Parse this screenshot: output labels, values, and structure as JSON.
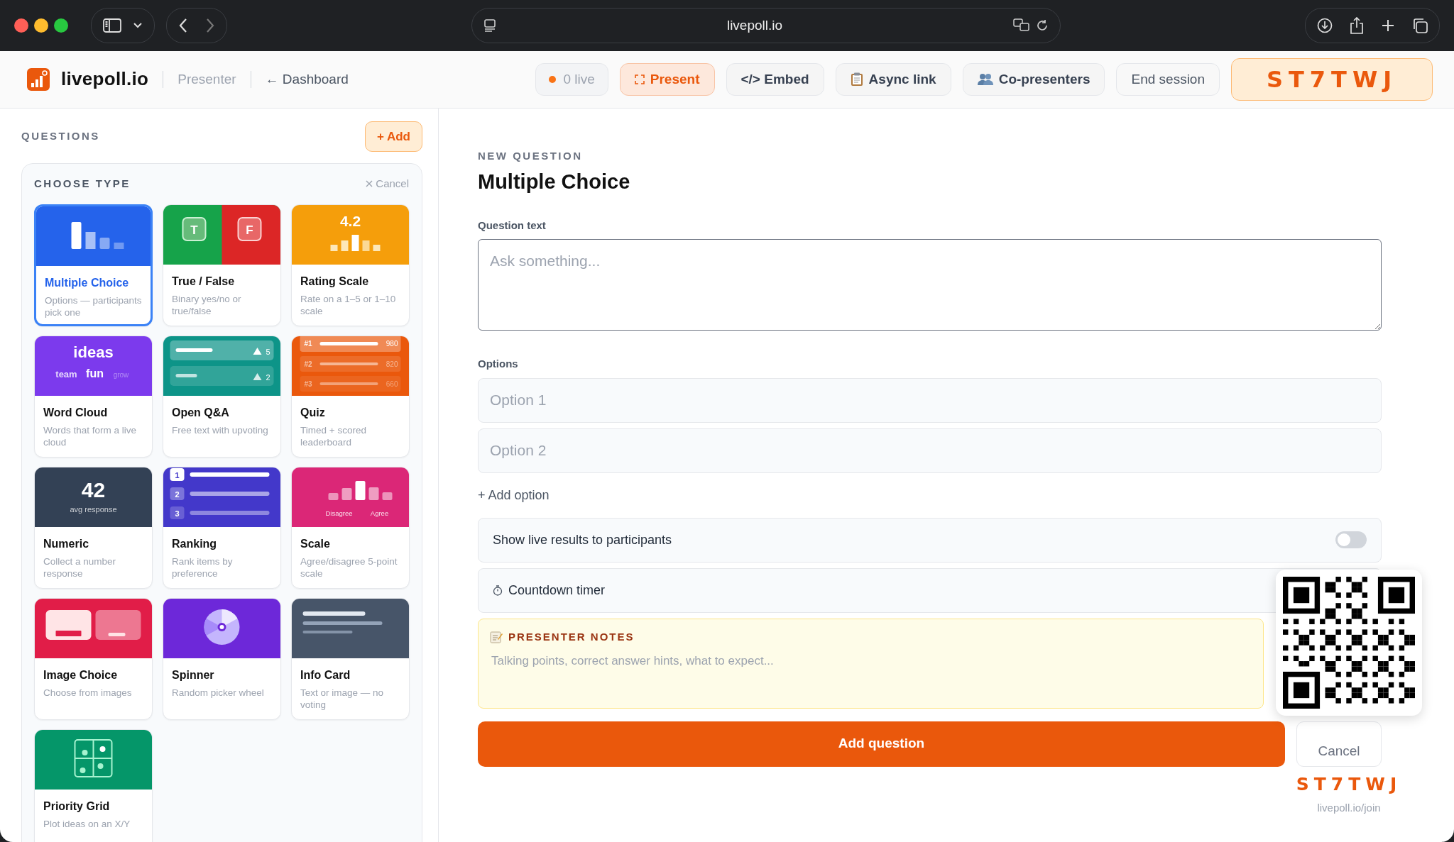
{
  "browser": {
    "url": "livepoll.io"
  },
  "header": {
    "brand": "livepoll.io",
    "role": "Presenter",
    "back_link": "← Dashboard",
    "live": {
      "label": "0 live",
      "on": false
    },
    "actions": [
      {
        "label": "Present",
        "kind": "present",
        "selected": true
      },
      {
        "label": "</> Embed",
        "kind": "plain",
        "selected": false
      },
      {
        "label": "Async link",
        "kind": "clipboard",
        "selected": false
      },
      {
        "label": "Co-presenters",
        "kind": "people",
        "selected": false
      },
      {
        "label": "End session",
        "kind": "muted",
        "selected": false
      }
    ],
    "code": "ST7TWJ"
  },
  "sidebar": {
    "title": "QUESTIONS",
    "add_button": "+ Add",
    "chooser": {
      "title": "CHOOSE TYPE",
      "cancel": "Cancel",
      "types": [
        {
          "kind": "mc",
          "title": "Multiple Choice",
          "description": "Options — participants pick one",
          "selected": true
        },
        {
          "kind": "tf",
          "title": "True / False",
          "description": "Binary yes/no or true/false",
          "selected": false,
          "art": [
            "T",
            "F"
          ]
        },
        {
          "kind": "rating",
          "title": "Rating Scale",
          "description": "Rate on a 1–5 or 1–10 scale",
          "selected": false,
          "art": [
            "4.2"
          ]
        },
        {
          "kind": "cloud",
          "title": "Word Cloud",
          "description": "Words that form a live cloud",
          "selected": false,
          "art": [
            "ideas",
            "team",
            "fun",
            "grow"
          ]
        },
        {
          "kind": "qa",
          "title": "Open Q&A",
          "description": "Free text with upvoting",
          "selected": false,
          "art": [
            "5",
            "2"
          ]
        },
        {
          "kind": "quiz",
          "title": "Quiz",
          "description": "Timed + scored leaderboard",
          "selected": false,
          "art": [
            "#1",
            "980",
            "#2",
            "820",
            "#3",
            "660"
          ]
        },
        {
          "kind": "numeric",
          "title": "Numeric",
          "description": "Collect a number response",
          "selected": false,
          "art": [
            "42",
            "avg response"
          ]
        },
        {
          "kind": "ranking",
          "title": "Ranking",
          "description": "Rank items by preference",
          "selected": false,
          "art": [
            "1",
            "2",
            "3"
          ]
        },
        {
          "kind": "scale",
          "title": "Scale",
          "description": "Agree/disagree 5-point scale",
          "selected": false,
          "art": [
            "Disagree",
            "Agree"
          ]
        },
        {
          "kind": "image",
          "title": "Image Choice",
          "description": "Choose from images",
          "selected": false
        },
        {
          "kind": "spinner",
          "title": "Spinner",
          "description": "Random picker wheel",
          "selected": false
        },
        {
          "kind": "info",
          "title": "Info Card",
          "description": "Text or image — no voting",
          "selected": false
        },
        {
          "kind": "grid",
          "title": "Priority Grid",
          "description": "Plot ideas on an X/Y",
          "selected": false
        }
      ]
    }
  },
  "editor": {
    "eyebrow": "NEW QUESTION",
    "title": "Multiple Choice",
    "question_label": "Question text",
    "question_placeholder": "Ask something...",
    "options_label": "Options",
    "options": [
      {
        "placeholder": "Option 1"
      },
      {
        "placeholder": "Option 2"
      }
    ],
    "add_option": "+ Add option",
    "live_results": {
      "label": "Show live results to participants",
      "on": false
    },
    "countdown": {
      "label": "Countdown timer"
    },
    "notes": {
      "title": "PRESENTER NOTES",
      "placeholder": "Talking points, correct answer hints, what to expect..."
    },
    "submit": "Add question",
    "cancel": "Cancel"
  },
  "join_overlay": {
    "code": "ST7TWJ",
    "url": "livepoll.io/join"
  }
}
